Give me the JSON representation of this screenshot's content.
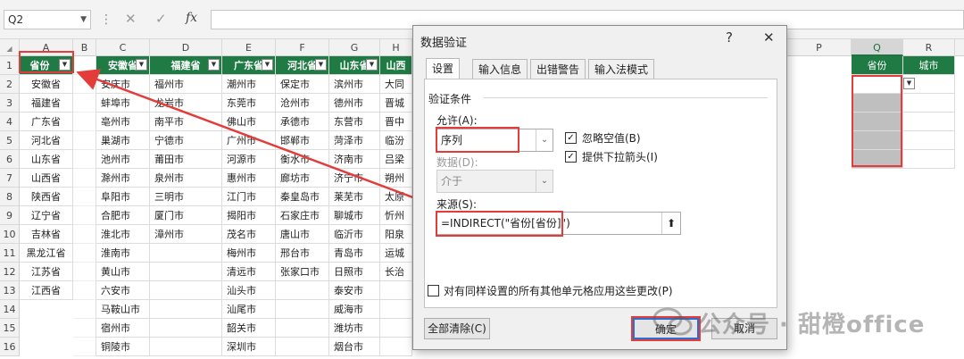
{
  "formula_bar": {
    "name_box": "Q2",
    "fx_label": "fx"
  },
  "columns": [
    "A",
    "B",
    "C",
    "D",
    "E",
    "F",
    "G",
    "H",
    "",
    "",
    "",
    "",
    "",
    "",
    "P",
    "Q",
    "R"
  ],
  "rows": [
    "1",
    "2",
    "3",
    "4",
    "5",
    "6",
    "7",
    "8",
    "9",
    "10",
    "11",
    "12",
    "13",
    "14",
    "15",
    "16"
  ],
  "sheet": {
    "col_a_header": "省份",
    "provinces": [
      "安徽省",
      "福建省",
      "广东省",
      "河北省",
      "山东省",
      "山西省",
      "陕西省",
      "辽宁省",
      "吉林省",
      "黑龙江省",
      "江苏省",
      "江西省"
    ],
    "table_headers": [
      "安徽省",
      "福建省",
      "广东省",
      "河北省",
      "山东省",
      "山西"
    ],
    "city_cols": [
      [
        "安庆市",
        "蚌埠市",
        "亳州市",
        "巢湖市",
        "池州市",
        "滁州市",
        "阜阳市",
        "合肥市",
        "淮北市",
        "淮南市",
        "黄山市",
        "六安市",
        "马鞍山市",
        "宿州市",
        "铜陵市"
      ],
      [
        "福州市",
        "龙岩市",
        "南平市",
        "宁德市",
        "莆田市",
        "泉州市",
        "三明市",
        "厦门市",
        "漳州市",
        "",
        "",
        "",
        "",
        "",
        ""
      ],
      [
        "潮州市",
        "东莞市",
        "佛山市",
        "广州市",
        "河源市",
        "惠州市",
        "江门市",
        "揭阳市",
        "茂名市",
        "梅州市",
        "清远市",
        "汕头市",
        "汕尾市",
        "韶关市",
        "深圳市"
      ],
      [
        "保定市",
        "沧州市",
        "承德市",
        "邯郸市",
        "衡水市",
        "廊坊市",
        "秦皇岛市",
        "石家庄市",
        "唐山市",
        "邢台市",
        "张家口市",
        "",
        "",
        "",
        ""
      ],
      [
        "滨州市",
        "德州市",
        "东营市",
        "菏泽市",
        "济南市",
        "济宁市",
        "莱芜市",
        "聊城市",
        "临沂市",
        "青岛市",
        "日照市",
        "泰安市",
        "威海市",
        "潍坊市",
        "烟台市"
      ],
      [
        "大同",
        "晋城",
        "晋中",
        "临汾",
        "吕梁",
        "朔州",
        "太原",
        "忻州",
        "阳泉",
        "运城",
        "长治",
        "",
        "",
        "",
        ""
      ]
    ],
    "q_header": "省份",
    "r_header": "城市"
  },
  "dialog": {
    "title": "数据验证",
    "help": "?",
    "close": "✕",
    "tabs": [
      "设置",
      "输入信息",
      "出错警告",
      "输入法模式"
    ],
    "group_label": "验证条件",
    "allow_label": "允许(A):",
    "allow_value": "序列",
    "data_label": "数据(D):",
    "data_value": "介于",
    "ignore_blank": "忽略空值(B)",
    "dropdown_arrow": "提供下拉箭头(I)",
    "source_label": "来源(S):",
    "source_value": "=INDIRECT(\"省份[省份]\")",
    "apply_all": "对有同样设置的所有其他单元格应用这些更改(P)",
    "clear_all": "全部清除(C)",
    "ok": "确定",
    "cancel": "取消"
  },
  "watermark": "公众号 · 甜橙office",
  "colors": {
    "header_green": "#1f7a44",
    "highlight_red": "#e43b3b",
    "selected_gray": "#bfbfbf"
  }
}
